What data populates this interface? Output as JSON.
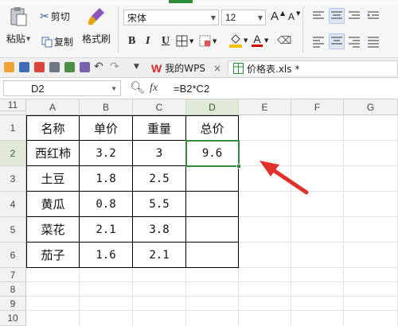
{
  "ribbon": {
    "paste_label": "粘贴",
    "cut_label": "剪切",
    "copy_label": "复制",
    "format_painter_label": "格式刷",
    "font_name": "宋体",
    "font_size": "12",
    "grow_font": "A",
    "shrink_font": "A",
    "bold": "B",
    "italic": "I",
    "underline": "U",
    "font_color_letter": "A",
    "font_color": "#d40000",
    "fill_color": "#f2c200",
    "wps_brand_color": "#d9262d"
  },
  "quick_access": {
    "wps_tab_label": "我的WPS",
    "doc_tab_label": "价格表.xls *",
    "close_glyph": "×"
  },
  "formula_bar": {
    "name_box": "D2",
    "fx_label": "fx",
    "formula": "=B2*C2"
  },
  "sheet": {
    "columns": [
      "A",
      "B",
      "C",
      "D",
      "E",
      "F",
      "G"
    ],
    "rows": [
      "1",
      "2",
      "3",
      "4",
      "5",
      "6",
      "7",
      "8",
      "9",
      "10",
      "11"
    ],
    "header": [
      "名称",
      "单价",
      "重量",
      "总价"
    ],
    "data": [
      [
        "西红柿",
        "3.2",
        "3",
        "9.6"
      ],
      [
        "土豆",
        "1.8",
        "2.5",
        ""
      ],
      [
        "黄瓜",
        "0.8",
        "5.5",
        ""
      ],
      [
        "菜花",
        "2.1",
        "3.8",
        ""
      ],
      [
        "茄子",
        "1.6",
        "2.1",
        ""
      ]
    ],
    "selected_cell": "D2",
    "selection_color": "#2e8b3a"
  },
  "annotation": {
    "arrow_color": "#e0302c",
    "arrow_icon": "red-arrow"
  }
}
